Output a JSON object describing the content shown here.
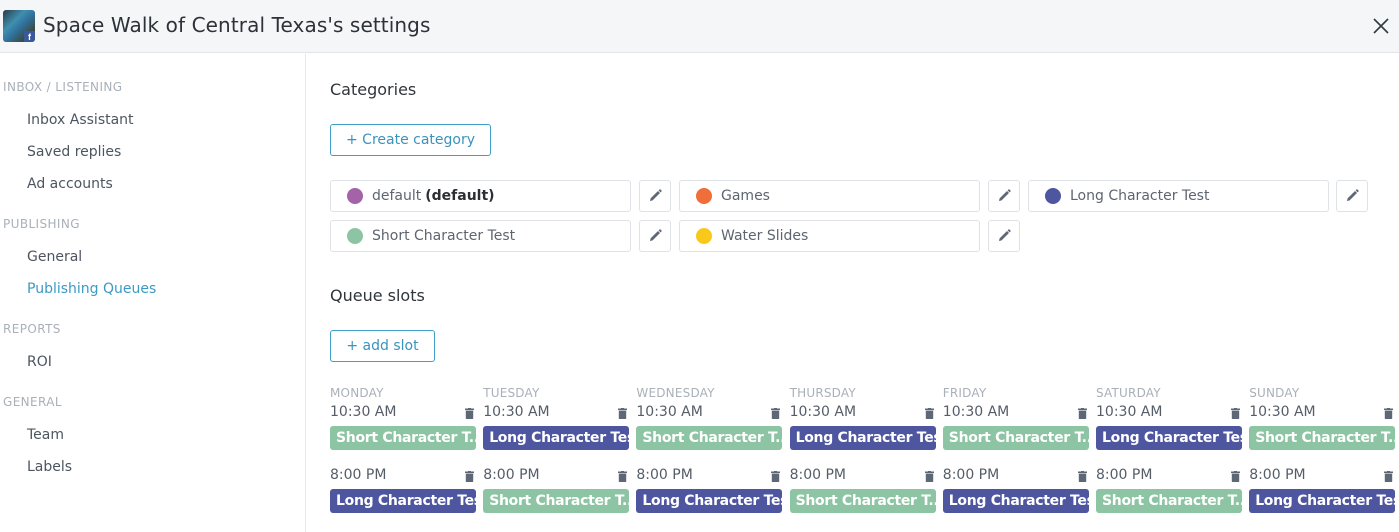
{
  "header": {
    "title": "Space Walk of Central Texas's settings",
    "avatar_icon": "facebook-page-avatar",
    "close_icon": "close-icon"
  },
  "sidebar": {
    "sections": [
      {
        "label": "INBOX / LISTENING",
        "items": [
          {
            "label": "Inbox Assistant"
          },
          {
            "label": "Saved replies"
          },
          {
            "label": "Ad accounts"
          }
        ]
      },
      {
        "label": "PUBLISHING",
        "items": [
          {
            "label": "General"
          },
          {
            "label": "Publishing Queues",
            "active": true
          }
        ]
      },
      {
        "label": "REPORTS",
        "items": [
          {
            "label": "ROI"
          }
        ]
      },
      {
        "label": "GENERAL",
        "items": [
          {
            "label": "Team"
          },
          {
            "label": "Labels"
          }
        ]
      }
    ],
    "active_color": "#3a9ac4"
  },
  "categories": {
    "heading": "Categories",
    "create_label": "+ Create category",
    "items": [
      {
        "name": "default",
        "suffix": "(default)",
        "color": "#a463a8"
      },
      {
        "name": "Games",
        "suffix": "",
        "color": "#f06e3a"
      },
      {
        "name": "Long Character Test",
        "suffix": "",
        "color": "#4f56a0"
      },
      {
        "name": "Short Character Test",
        "suffix": "",
        "color": "#8dc4a3"
      },
      {
        "name": "Water Slides",
        "suffix": "",
        "color": "#f8c81a"
      }
    ]
  },
  "queue": {
    "heading": "Queue slots",
    "add_label": "+ add slot",
    "tag_colors": {
      "Long Character Test": "#4f56a0",
      "Short Character Test": "#8dc4a3"
    },
    "days": [
      {
        "name": "MONDAY",
        "slots": [
          {
            "time": "10:30 AM",
            "tag": "Short Character T..."
          },
          {
            "time": "8:00 PM",
            "tag": "Long Character Test"
          }
        ]
      },
      {
        "name": "TUESDAY",
        "slots": [
          {
            "time": "10:30 AM",
            "tag": "Long Character Test"
          },
          {
            "time": "8:00 PM",
            "tag": "Short Character T..."
          }
        ]
      },
      {
        "name": "WEDNESDAY",
        "slots": [
          {
            "time": "10:30 AM",
            "tag": "Short Character T..."
          },
          {
            "time": "8:00 PM",
            "tag": "Long Character Test"
          }
        ]
      },
      {
        "name": "THURSDAY",
        "slots": [
          {
            "time": "10:30 AM",
            "tag": "Long Character Test"
          },
          {
            "time": "8:00 PM",
            "tag": "Short Character T..."
          }
        ]
      },
      {
        "name": "FRIDAY",
        "slots": [
          {
            "time": "10:30 AM",
            "tag": "Short Character T..."
          },
          {
            "time": "8:00 PM",
            "tag": "Long Character Test"
          }
        ]
      },
      {
        "name": "SATURDAY",
        "slots": [
          {
            "time": "10:30 AM",
            "tag": "Long Character Test"
          },
          {
            "time": "8:00 PM",
            "tag": "Short Character T..."
          }
        ]
      },
      {
        "name": "SUNDAY",
        "slots": [
          {
            "time": "10:30 AM",
            "tag": "Short Character T..."
          },
          {
            "time": "8:00 PM",
            "tag": "Long Character Test"
          }
        ]
      }
    ]
  }
}
